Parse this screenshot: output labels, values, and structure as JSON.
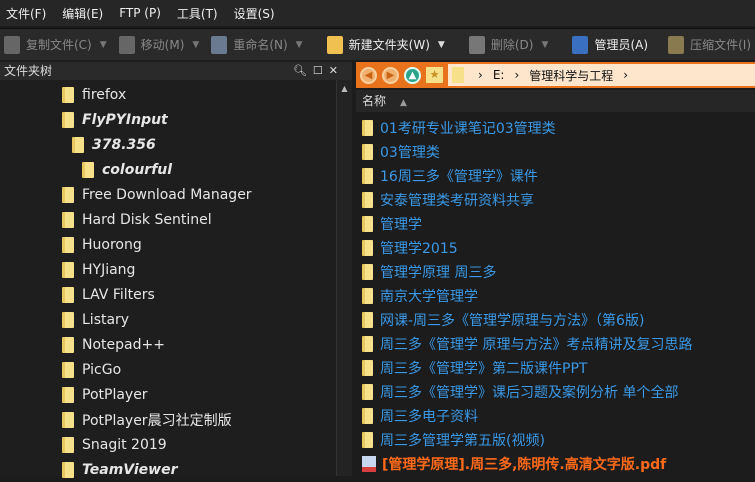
{
  "menu": [
    "文件(F)",
    "编辑(E)",
    "FTP (P)",
    "工具(T)",
    "设置(S)"
  ],
  "toolbar": [
    {
      "label": "复制文件(C)",
      "icon": "copy-icon",
      "enabled": false,
      "dropdown": true
    },
    {
      "label": "移动(M)",
      "icon": "move-icon",
      "enabled": false,
      "dropdown": true
    },
    {
      "label": "重命名(N)",
      "icon": "rename-icon",
      "enabled": false,
      "dropdown": true
    },
    {
      "label": "新建文件夹(W)",
      "icon": "new-folder-icon",
      "enabled": true,
      "dropdown": true
    },
    {
      "label": "删除(D)",
      "icon": "delete-icon",
      "enabled": false,
      "dropdown": true
    },
    {
      "label": "管理员(A)",
      "icon": "admin-icon",
      "enabled": true,
      "dropdown": false
    },
    {
      "label": "压缩文件(I)",
      "icon": "compress-icon",
      "enabled": false,
      "dropdown": false
    }
  ],
  "tree": {
    "title": "文件夹树",
    "items": [
      {
        "label": "firefox",
        "level": 0,
        "bold": false
      },
      {
        "label": "FlyPYInput",
        "level": 0,
        "bold": true
      },
      {
        "label": "378.356",
        "level": 1,
        "bold": true
      },
      {
        "label": "colourful",
        "level": 2,
        "bold": true
      },
      {
        "label": "Free Download Manager",
        "level": 0,
        "bold": false
      },
      {
        "label": "Hard Disk Sentinel",
        "level": 0,
        "bold": false
      },
      {
        "label": "Huorong",
        "level": 0,
        "bold": false
      },
      {
        "label": "HYJiang",
        "level": 0,
        "bold": false
      },
      {
        "label": "LAV Filters",
        "level": 0,
        "bold": false
      },
      {
        "label": "Listary",
        "level": 0,
        "bold": false
      },
      {
        "label": "Notepad++",
        "level": 0,
        "bold": false
      },
      {
        "label": "PicGo",
        "level": 0,
        "bold": false
      },
      {
        "label": "PotPlayer",
        "level": 0,
        "bold": false
      },
      {
        "label": "PotPlayer晨习社定制版",
        "level": 0,
        "bold": false
      },
      {
        "label": "Snagit 2019",
        "level": 0,
        "bold": false
      },
      {
        "label": "TeamViewer",
        "level": 0,
        "bold": true
      }
    ]
  },
  "breadcrumb": [
    "E:",
    "管理科学与工程"
  ],
  "columns": {
    "name": "名称"
  },
  "files": [
    {
      "name": "01考研专业课笔记03管理类",
      "type": "folder"
    },
    {
      "name": "03管理类",
      "type": "folder"
    },
    {
      "name": "16周三多《管理学》课件",
      "type": "folder"
    },
    {
      "name": "安泰管理类考研资料共享",
      "type": "folder"
    },
    {
      "name": "管理学",
      "type": "folder"
    },
    {
      "name": "管理学2015",
      "type": "folder"
    },
    {
      "name": "管理学原理 周三多",
      "type": "folder"
    },
    {
      "name": "南京大学管理学",
      "type": "folder"
    },
    {
      "name": "网课-周三多《管理学原理与方法》（第6版)",
      "type": "folder"
    },
    {
      "name": "周三多《管理学 原理与方法》考点精讲及复习思路",
      "type": "folder"
    },
    {
      "name": "周三多《管理学》第二版课件PPT",
      "type": "folder"
    },
    {
      "name": "周三多《管理学》课后习题及案例分析 单个全部",
      "type": "folder"
    },
    {
      "name": "周三多电子资料",
      "type": "folder"
    },
    {
      "name": "周三多管理学第五版(视频)",
      "type": "folder"
    },
    {
      "name": "[管理学原理].周三多,陈明传.高清文字版.pdf",
      "type": "pdf"
    }
  ],
  "colors": {
    "folder_text": "#3a98e6",
    "pdf_text": "#ff6a1a",
    "nav_bar": "#e8731c"
  }
}
